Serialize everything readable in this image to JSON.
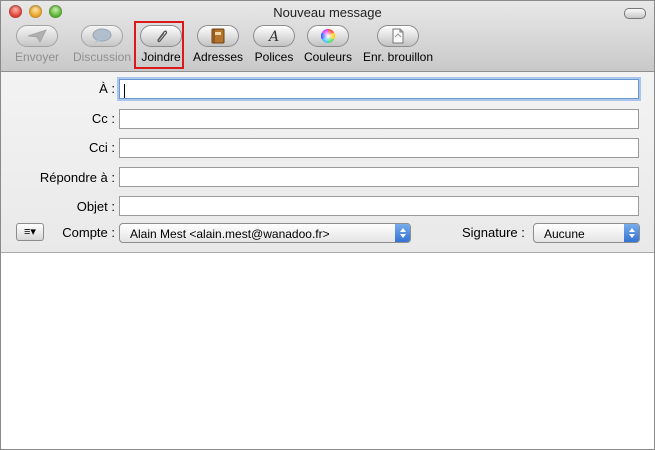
{
  "window": {
    "title": "Nouveau message"
  },
  "toolbar": {
    "envoyer": "Envoyer",
    "discussion": "Discussion",
    "joindre": "Joindre",
    "adresses": "Adresses",
    "polices": "Polices",
    "couleurs": "Couleurs",
    "enr_brouillon": "Enr. brouillon"
  },
  "fields": {
    "to_label": "À :",
    "to_value": "",
    "cc_label": "Cc :",
    "cc_value": "",
    "bcc_label": "Cci :",
    "bcc_value": "",
    "reply_to_label": "Répondre à :",
    "reply_to_value": "",
    "subject_label": "Objet :",
    "subject_value": ""
  },
  "account": {
    "label": "Compte :",
    "value": "Alain Mest <alain.mest@wanadoo.fr>"
  },
  "signature": {
    "label": "Signature :",
    "value": "Aucune"
  },
  "header_menu_glyph": "≡▾",
  "message_body": "",
  "icons": {
    "envoyer": "send-icon",
    "discussion": "chat-icon",
    "joindre": "paperclip-icon",
    "adresses": "address-book-icon",
    "polices": "fonts-icon",
    "couleurs": "color-wheel-icon",
    "enr_brouillon": "save-draft-icon"
  },
  "colors": {
    "highlight": "#d81a1a",
    "focus_ring": "#a9c6ef",
    "popup_arrows": "#2f6fd1"
  }
}
